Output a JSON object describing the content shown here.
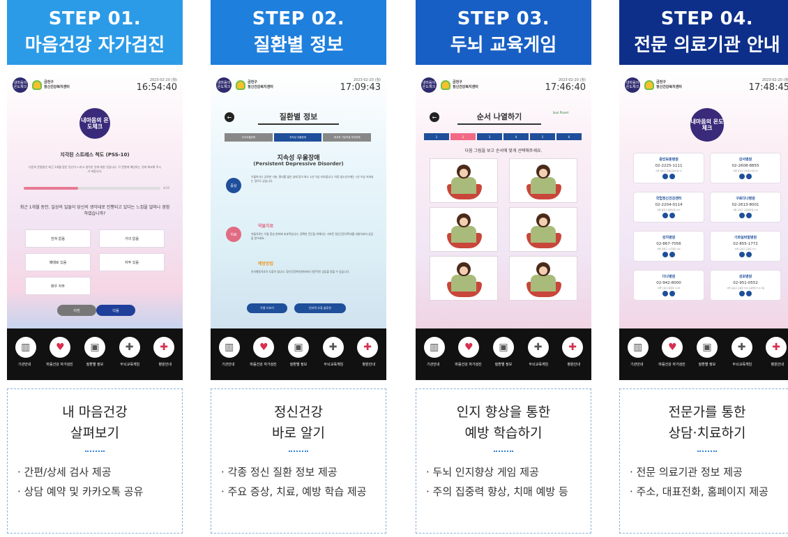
{
  "columns": [
    {
      "step": "STEP 01.",
      "title": "마음건강 자가검진",
      "caption_main": [
        "내 마음건강",
        "살펴보기"
      ],
      "bullets": [
        "· 간편/상세 검사 제공",
        "· 상담 예약 및 카카오톡 공유"
      ]
    },
    {
      "step": "STEP 02.",
      "title": "질환별 정보",
      "caption_main": [
        "정신건강",
        "바로 알기"
      ],
      "bullets": [
        "· 각종 정신 질환 정보 제공",
        "· 주요 증상, 치료, 예방 학습 제공"
      ]
    },
    {
      "step": "STEP 03.",
      "title": "두뇌 교육게임",
      "caption_main": [
        "인지 향상을 통한",
        "예방 학습하기"
      ],
      "bullets": [
        "· 두뇌 인지향상 게임 제공",
        "· 주의 집중력 향상, 치매 예방 등"
      ]
    },
    {
      "step": "STEP 04.",
      "title": "전문 의료기관 안내",
      "caption_main": [
        "전문가를 통한",
        "상담·치료하기"
      ],
      "bullets": [
        "· 전문 의료기관 정보 제공",
        "· 주소, 대표전화, 홈페이지 제공"
      ]
    }
  ],
  "common": {
    "app_logo": "내마음의 온도체크",
    "center_name_1": "금천구",
    "center_name_2": "정신건강복지센터",
    "date": "2023-02-20 (월)",
    "nav": [
      "기관안내",
      "마음건강 자가검진",
      "질환별 정보",
      "두뇌교육게임",
      "병원안내"
    ],
    "nav_icons": [
      "building-icon",
      "heart-icon",
      "id-card-icon",
      "gamepad-icon",
      "hospital-icon"
    ]
  },
  "screen1": {
    "time": "16:54:40",
    "test_title": "지각된 스트레스 척도 (PSS-10)",
    "desc": "다음의 문항들은 최근 1개월 동안 당신이 느끼고 생각한 것에 대한 것입니다. 각 문항에 해당하는 곳에 체크해 주시기 바랍니다.",
    "progress_label": "4/10",
    "progress": 0.4,
    "question": "최근 1개월 동안, 일상의 일들이 당신의 생각대로 진행되고 있다는 느낌을 얼마나 경험하였습니까?",
    "options": [
      "전혀 없음",
      "거의 없음",
      "때때로 있음",
      "자주 있음",
      "매우 자주"
    ],
    "prev": "이전",
    "next": "다음"
  },
  "screen2": {
    "time": "17:09:43",
    "title": "질환별 정보",
    "crumbs": [
      "주요우울장애",
      "지속성 우울장애",
      "파괴적 기분조절 부전장애"
    ],
    "disease": "지속성 우울장애",
    "disease_en": "(Persistent Depressive Disorder)",
    "symptom_badge": "증상",
    "symptom_text": "우울하거나 공허한 기분, 흥미를 잃은 상태 등이 최소 2년 이상 지속됩니다. 아동·청소년기에는 1년 이상 지속되는 경우도 있습니다.",
    "treat_badge": "치료",
    "treat_title": "약물치료",
    "treat_text": "약물치료는 우울 증상 완화에 효과적입니다. 정확한 진단을 위해서는 가까운 정신건강의학과를 내원하셔서 상담을 받으세요.",
    "prevent_title": "예방방법",
    "prevent_text": "인지행동치료가 도움이 됩니다. 정신건강복지센터에서 전문적인 상담을 받을 수 있습니다.",
    "btn1": "우울 더보기",
    "btn2": "인지적 오류 솔루션"
  },
  "screen3": {
    "time": "17:46:40",
    "title": "순서 나열하기",
    "planet": "Soul Planet",
    "steps": [
      "1",
      "2",
      "3",
      "4",
      "5",
      "6"
    ],
    "instruction": "다음 그림을 보고 순서에 맞게 선택해주세요."
  },
  "screen4": {
    "time": "17:48:45",
    "hospitals": [
      {
        "name": "중앙보훈병원",
        "phone": "02-2225-1111",
        "addr": "서울 강동구 진황도로61길 53"
      },
      {
        "name": "강서병원",
        "phone": "02-2608-8855",
        "addr": "서울 강서구 강서로17길 24"
      },
      {
        "name": "국립정신건강센터",
        "phone": "02-2204-0114",
        "addr": "서울 광진구 용마산로 127"
      },
      {
        "name": "구로다나병원",
        "phone": "02-2613-8001",
        "addr": "서울 구로구 구로중앙로 125"
      },
      {
        "name": "성지병원",
        "phone": "02-867-7056",
        "addr": "서울 금천구 시흥대로 122"
      },
      {
        "name": "기화실버힐병원",
        "phone": "02-855-1772",
        "addr": "서울 도봉구 도봉로 117"
      },
      {
        "name": "다나병원",
        "phone": "02-942-8000",
        "addr": "서울 노원구 동일로 1126"
      },
      {
        "name": "성모병원",
        "phone": "02-951-0552",
        "addr": "서울 도봉구 도봉로 403 도봉빌딩 5,6,7층"
      }
    ]
  }
}
